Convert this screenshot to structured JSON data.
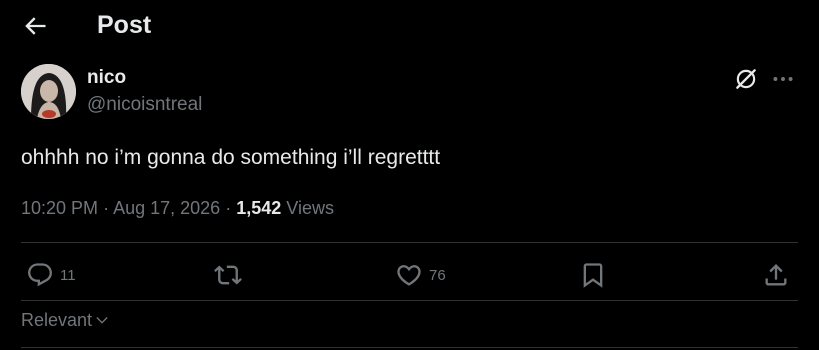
{
  "header": {
    "title": "Post"
  },
  "author": {
    "display_name": "nico",
    "handle": "@nicoisntreal"
  },
  "post": {
    "text": "ohhhh no i’m gonna do something i’ll regretttt",
    "time": "10:20 PM",
    "date": "Aug 17, 2026",
    "views_count": "1,542",
    "views_label": "Views",
    "separator": "·"
  },
  "actions": {
    "reply_count": "11",
    "like_count": "76"
  },
  "replies_sort": {
    "label": "Relevant"
  },
  "icons": [
    "back-arrow-icon",
    "grok-icon",
    "more-icon",
    "reply-icon",
    "repost-icon",
    "like-icon",
    "bookmark-icon",
    "share-icon",
    "chevron-down-icon"
  ],
  "colors": {
    "background": "#000000",
    "text": "#e7e9ea",
    "secondary": "#71767b",
    "divider": "#2f3336"
  }
}
